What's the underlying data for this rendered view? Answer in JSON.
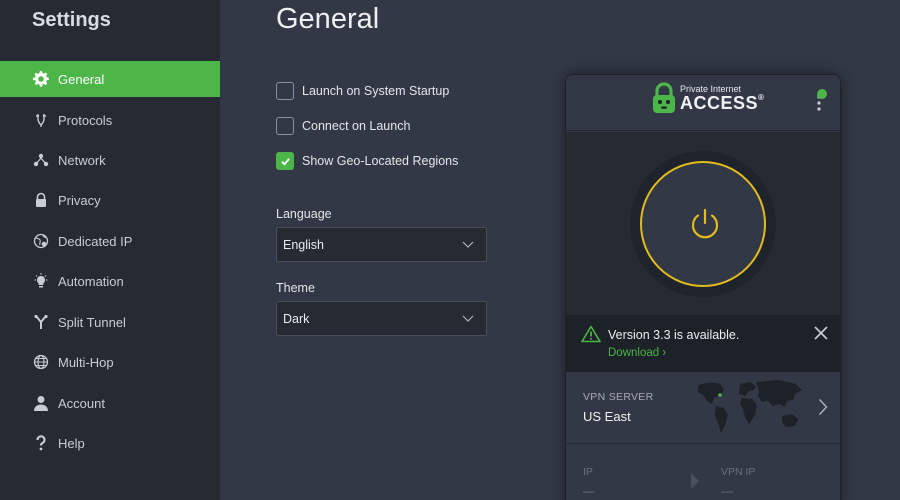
{
  "sidebar": {
    "title": "Settings",
    "items": [
      {
        "label": "General",
        "icon": "gear-icon",
        "active": true
      },
      {
        "label": "Protocols",
        "icon": "protocol-icon",
        "active": false
      },
      {
        "label": "Network",
        "icon": "network-icon",
        "active": false
      },
      {
        "label": "Privacy",
        "icon": "lock-icon",
        "active": false
      },
      {
        "label": "Dedicated IP",
        "icon": "globe-pin-icon",
        "active": false
      },
      {
        "label": "Automation",
        "icon": "lightbulb-icon",
        "active": false
      },
      {
        "label": "Split Tunnel",
        "icon": "split-icon",
        "active": false
      },
      {
        "label": "Multi-Hop",
        "icon": "globe-icon",
        "active": false
      },
      {
        "label": "Account",
        "icon": "user-icon",
        "active": false
      },
      {
        "label": "Help",
        "icon": "question-icon",
        "active": false
      }
    ]
  },
  "main": {
    "title": "General",
    "checkboxes": [
      {
        "label": "Launch on System Startup",
        "checked": false
      },
      {
        "label": "Connect on Launch",
        "checked": false
      },
      {
        "label": "Show Geo-Located Regions",
        "checked": true
      }
    ],
    "language": {
      "label": "Language",
      "value": "English"
    },
    "theme": {
      "label": "Theme",
      "value": "Dark"
    }
  },
  "client": {
    "logo_small": "Private Internet",
    "logo_big": "ACCESS",
    "logo_mark": "®",
    "notice_text": "Version 3.3 is available.",
    "notice_link": "Download ›",
    "server_label": "VPN SERVER",
    "server_value": "US East",
    "ip_label": "IP",
    "ip_value": "—",
    "vpn_ip_label": "VPN IP",
    "vpn_ip_value": "—"
  },
  "colors": {
    "accent": "#4cb649",
    "power_ring": "#e2bc1e",
    "sidebar_bg": "#252a33",
    "main_bg": "#323846"
  }
}
